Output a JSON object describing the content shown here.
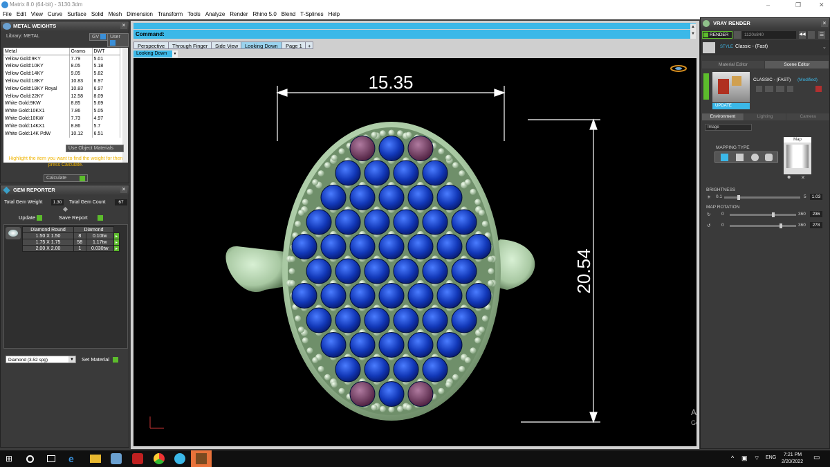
{
  "window": {
    "title": "Matrix 8.0 (64-bit) - 3130.3dm"
  },
  "menu": [
    "File",
    "Edit",
    "View",
    "Curve",
    "Surface",
    "Solid",
    "Mesh",
    "Dimension",
    "Transform",
    "Tools",
    "Analyze",
    "Render",
    "Rhino 5.0",
    "Blend",
    "T-Splines",
    "Help"
  ],
  "metal_weights": {
    "title": "METAL WEIGHTS",
    "library_label": "Library: METAL",
    "gv_label": "GV",
    "user_label": "User",
    "headers": [
      "Metal",
      "Grams",
      "DWT"
    ],
    "rows": [
      [
        "Yellow Gold:9KY",
        "7.79",
        "5.01"
      ],
      [
        "Yellow Gold:10KY",
        "8.05",
        "5.18"
      ],
      [
        "Yellow Gold:14KY",
        "9.05",
        "5.82"
      ],
      [
        "Yellow Gold:18KY",
        "10.83",
        "6.97"
      ],
      [
        "Yellow Gold:18KY Royal",
        "10.83",
        "6.97"
      ],
      [
        "Yellow Gold:22KY",
        "12.58",
        "8.09"
      ],
      [
        "White Gold:9KW",
        "8.85",
        "5.69"
      ],
      [
        "White Gold:10KX1",
        "7.86",
        "5.05"
      ],
      [
        "White Gold:10KW",
        "7.73",
        "4.97"
      ],
      [
        "White Gold:14KX1",
        "8.86",
        "5.7"
      ],
      [
        "White Gold:14K PdW",
        "10.12",
        "6.51"
      ]
    ],
    "use_object_materials": "Use Object Materials",
    "hint": "Highlight the item you want to find the weight for then press Calculate.",
    "calculate": "Calculate"
  },
  "gem_reporter": {
    "title": "GEM REPORTER",
    "total_weight_label": "Total Gem Weight",
    "total_weight": "1.30",
    "total_count_label": "Total Gem Count",
    "total_count": "67",
    "update": "Update",
    "save_report": "Save Report",
    "headers": [
      "Diamond Round",
      "Diamond"
    ],
    "rows": [
      [
        "1.50 X 1.50",
        "8",
        "0.10tw"
      ],
      [
        "1.75 X 1.75",
        "58",
        "1.17tw"
      ],
      [
        "2.00 X 2.00",
        "1",
        "0.030tw"
      ]
    ],
    "material_select": "Diamond      (3.52 spg)",
    "set_material": "Set Material"
  },
  "command": {
    "label": "Command:"
  },
  "tabs": [
    "Perspective",
    "Through Finger",
    "Side View",
    "Looking Down",
    "Page 1"
  ],
  "active_tab": "Looking Down",
  "viewport_label": "Looking Down",
  "dimensions": {
    "width": "15.35",
    "height": "20.54"
  },
  "vray": {
    "title": "VRAY RENDER",
    "render": "RENDER",
    "resolution": "1120x840",
    "style_label": "STYLE",
    "style_value": "Classic - (Fast)",
    "tabs": [
      "Material Editor",
      "Scene Editor"
    ],
    "preset_name": "CLASSIC - (FAST)",
    "preset_state": "(Modified)",
    "update": "UPDATE",
    "env_tabs": [
      "Environment",
      "Lighting",
      "Camera"
    ],
    "env_type": "Image",
    "mapping_type": "MAPPING TYPE",
    "map_label": "Map",
    "brightness_label": "BRIGHTNESS",
    "brightness_min": "0.1",
    "brightness_max": "5",
    "brightness": "1.03",
    "brightness_fraction": 0.19,
    "map_rotation_label": "MAP ROTATION",
    "rot_min1": "0",
    "rot_max1": "360",
    "rot1": "236",
    "rot_min2": "0",
    "rot_max2": "360",
    "rot2": "278"
  },
  "watermark": {
    "line1": "Activate Windows",
    "line2": "Go to Settings to activate Windows."
  },
  "taskbar": {
    "time": "7:21 PM",
    "date": "2/20/2022",
    "lang": "ENG"
  }
}
